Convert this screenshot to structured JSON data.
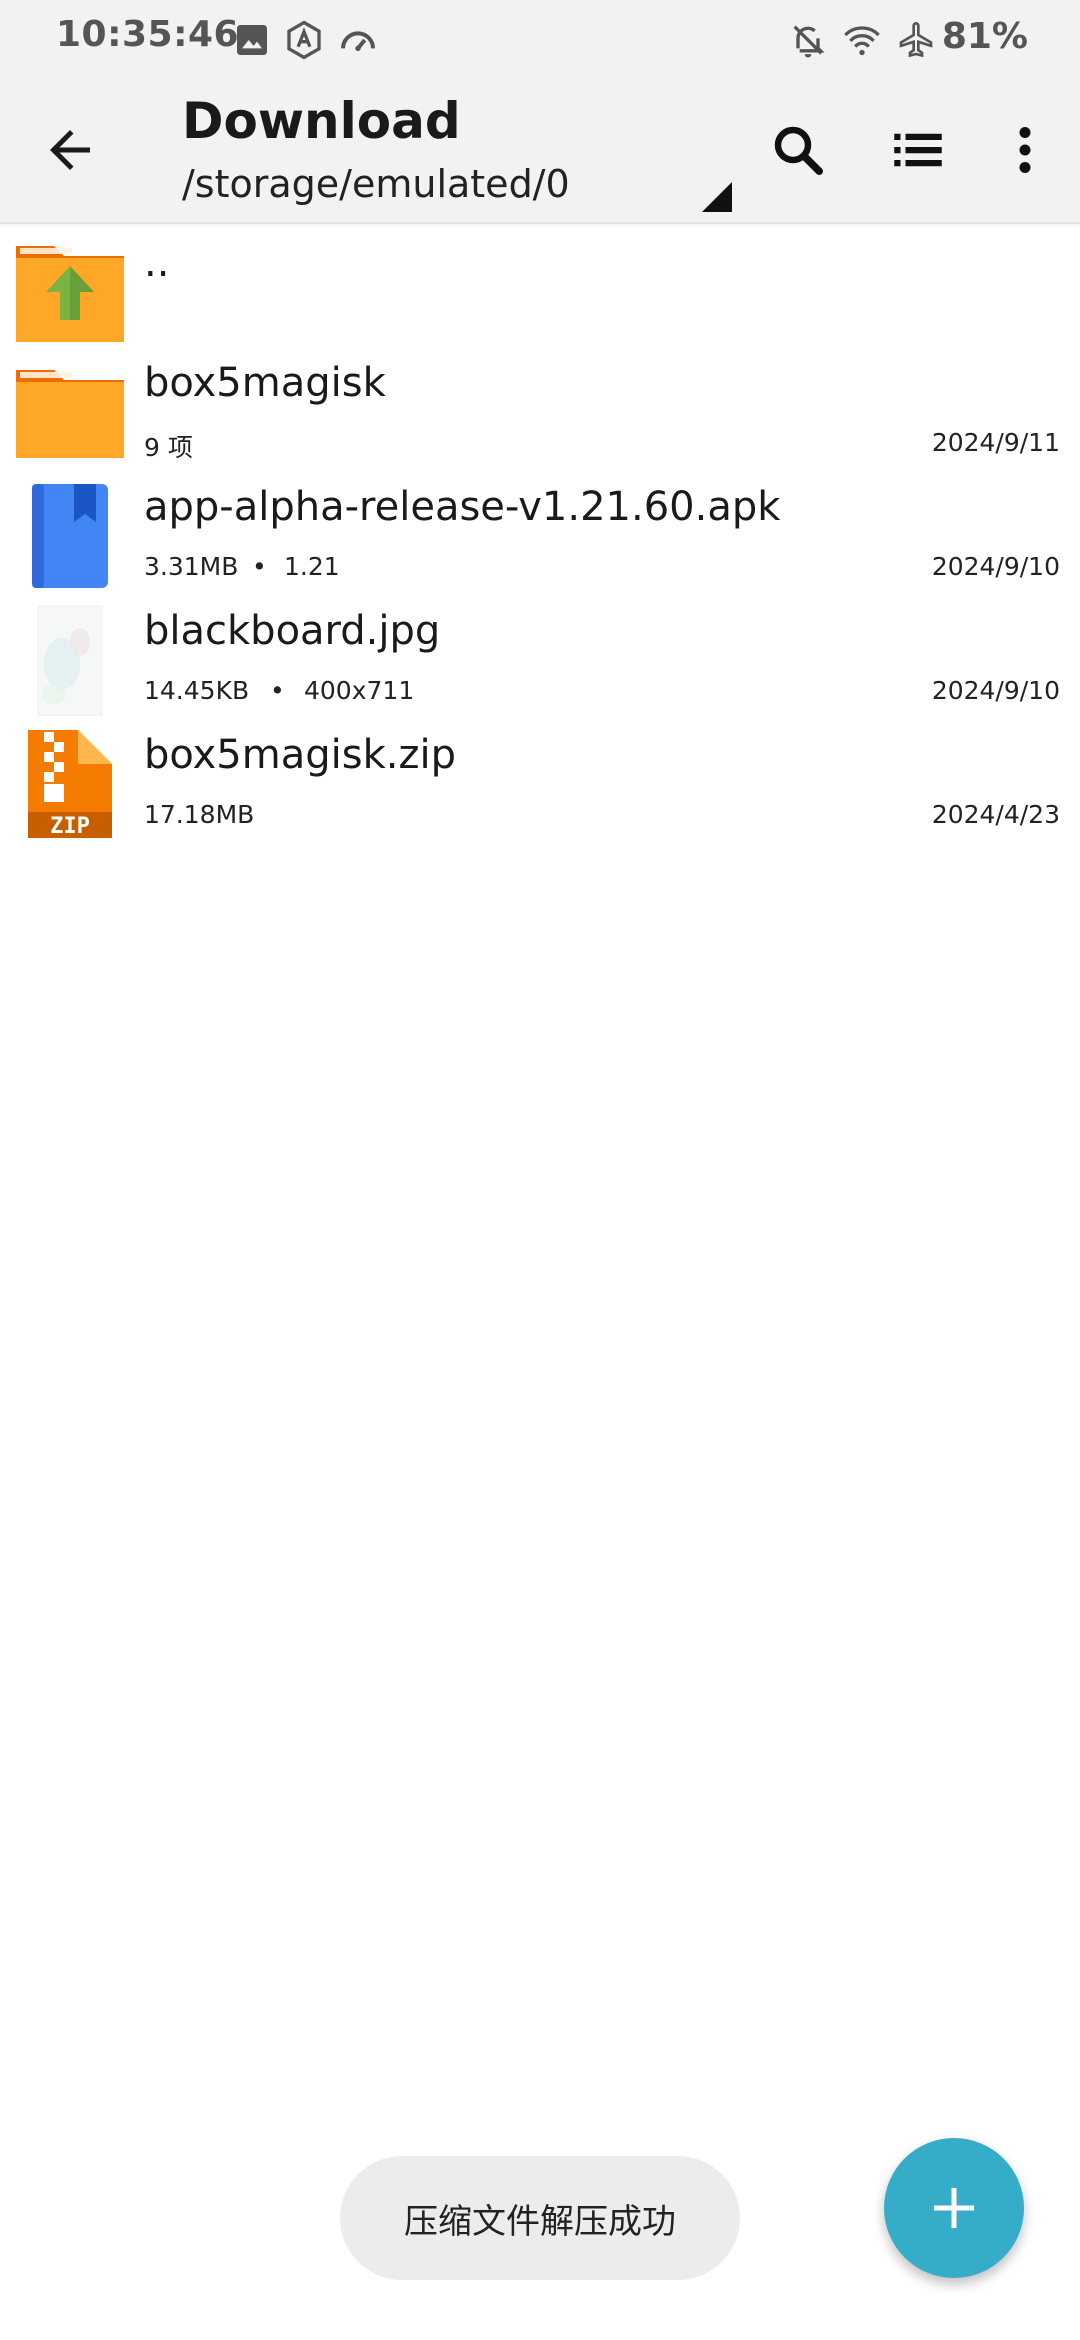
{
  "status_bar": {
    "time": "10:35:46",
    "battery": "81%",
    "left_icons": [
      "image-icon",
      "a-badge-icon",
      "speedometer-icon"
    ],
    "right_icons": [
      "bell-off-icon",
      "wifi-icon",
      "airplane-icon"
    ]
  },
  "app_bar": {
    "title": "Download",
    "path": "/storage/emulated/0",
    "actions": [
      "search-icon",
      "list-view-icon",
      "more-vert-icon"
    ]
  },
  "files": [
    {
      "name": "..",
      "meta": "",
      "meta2": "",
      "date": "",
      "type": "parent-folder"
    },
    {
      "name": "box5magisk",
      "meta": "9 项",
      "meta2": "",
      "date": "2024/9/11",
      "type": "folder"
    },
    {
      "name": "app-alpha-release-v1.21.60.apk",
      "meta": "3.31MB",
      "meta2": "1.21",
      "date": "2024/9/10",
      "type": "apk"
    },
    {
      "name": "blackboard.jpg",
      "meta": "14.45KB",
      "meta2": "400x711",
      "date": "2024/9/10",
      "type": "image"
    },
    {
      "name": "box5magisk.zip",
      "meta": "17.18MB",
      "meta2": "",
      "date": "2024/4/23",
      "type": "zip"
    }
  ],
  "toast": {
    "text": "压缩文件解压成功"
  },
  "fab": {
    "icon": "plus-icon"
  },
  "colors": {
    "bar_bg": "#f2f2f2",
    "folder": "#f9a825",
    "folder_dark": "#ef6c00",
    "apk": "#4285f4",
    "zip": "#f57c00",
    "fab": "#35adc9"
  }
}
